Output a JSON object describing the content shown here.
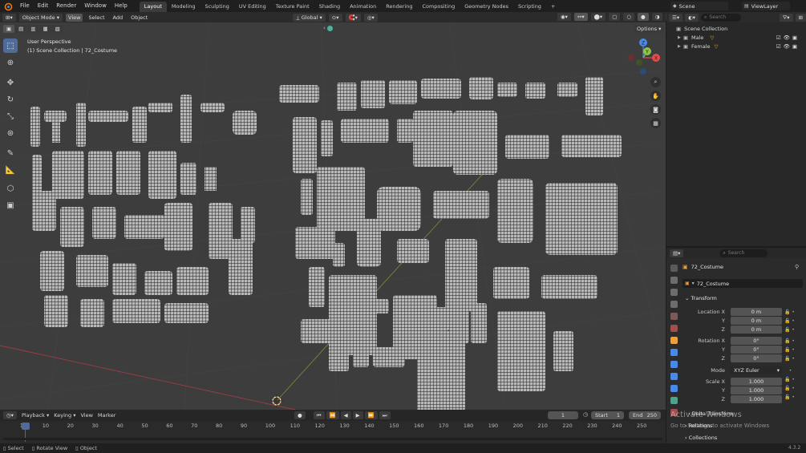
{
  "menus": [
    "File",
    "Edit",
    "Render",
    "Window",
    "Help"
  ],
  "workspaces": [
    "Layout",
    "Modeling",
    "Sculpting",
    "UV Editing",
    "Texture Paint",
    "Shading",
    "Animation",
    "Rendering",
    "Compositing",
    "Geometry Nodes",
    "Scripting"
  ],
  "scene": {
    "label": "Scene",
    "view_layer": "ViewLayer"
  },
  "viewport_header": {
    "mode": "Object Mode",
    "view": "View",
    "select": "Select",
    "add": "Add",
    "object": "Object",
    "transform_orientation": "Global",
    "options": "Options"
  },
  "viewport": {
    "perspective": "User Perspective",
    "collection_info": "(1) Scene Collection | 72_Costume"
  },
  "gizmo": {
    "x": "X",
    "y": "Y",
    "z": "Z"
  },
  "outliner": {
    "search_placeholder": "Search",
    "root": "Scene Collection",
    "items": [
      {
        "name": "Male"
      },
      {
        "name": "Female"
      }
    ]
  },
  "properties": {
    "search_placeholder": "Search",
    "object_name": "72_Costume",
    "object_datablock": "72_Costume",
    "transform_label": "Transform",
    "location": {
      "label": "Location X",
      "x": "0 m",
      "y": "0 m",
      "z": "0 m"
    },
    "rotation": {
      "label": "Rotation X",
      "x": "0°",
      "y": "0°",
      "z": "0°"
    },
    "mode": {
      "label": "Mode",
      "value": "XYZ Euler"
    },
    "scale": {
      "label": "Scale X",
      "x": "1.000",
      "y": "1.000",
      "z": "1.000"
    },
    "axis_y": "Y",
    "axis_z": "Z",
    "delta_transform": "Delta Transform",
    "relations": "Relations",
    "collections": "Collections"
  },
  "watermark": {
    "line1": "Activate Windows",
    "line2": "Go to Settings to activate Windows"
  },
  "timeline": {
    "playback": "Playback",
    "keying": "Keying",
    "view": "View",
    "marker": "Marker",
    "current_frame": "1",
    "start_label": "Start",
    "start": "1",
    "end_label": "End",
    "end": "250",
    "ticks": [
      "1",
      "10",
      "20",
      "30",
      "40",
      "50",
      "60",
      "70",
      "80",
      "90",
      "100",
      "110",
      "120",
      "130",
      "140",
      "150",
      "160",
      "170",
      "180",
      "190",
      "200",
      "210",
      "220",
      "230",
      "240",
      "250"
    ]
  },
  "statusbar": {
    "select": "Select",
    "rotate_view": "Rotate View",
    "object": "Object",
    "version": "4.3.2"
  },
  "colors": {
    "accent": "#4f6b99",
    "x_axis": "#e64b4b",
    "y_axis": "#8ec546",
    "z_axis": "#4a8ae6",
    "active_tab": "#3c3c3c"
  }
}
